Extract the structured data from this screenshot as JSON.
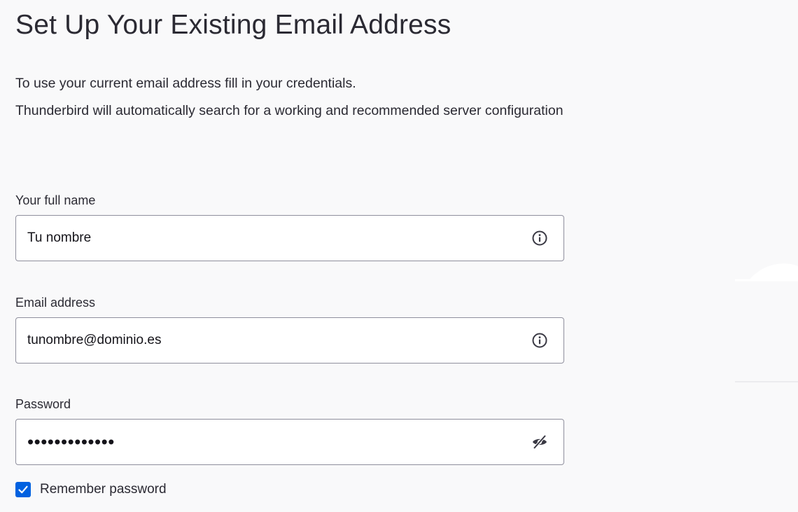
{
  "header": {
    "title": "Set Up Your Existing Email Address"
  },
  "description": {
    "line1": "To use your current email address fill in your credentials.",
    "line2": "Thunderbird will automatically search for a working and recommended server configuration"
  },
  "form": {
    "full_name": {
      "label": "Your full name",
      "value": "Tu nombre",
      "icon": "info-icon"
    },
    "email": {
      "label": "Email address",
      "value": "tunombre@dominio.es",
      "icon": "info-icon"
    },
    "password": {
      "label": "Password",
      "masked_value": "•••••••••••••",
      "icon": "eye-slash-icon"
    },
    "remember_password": {
      "label": "Remember password",
      "checked": true
    }
  },
  "colors": {
    "background": "#f9f9fa",
    "accent": "#0061e0",
    "field_border": "#8f8f9d"
  }
}
